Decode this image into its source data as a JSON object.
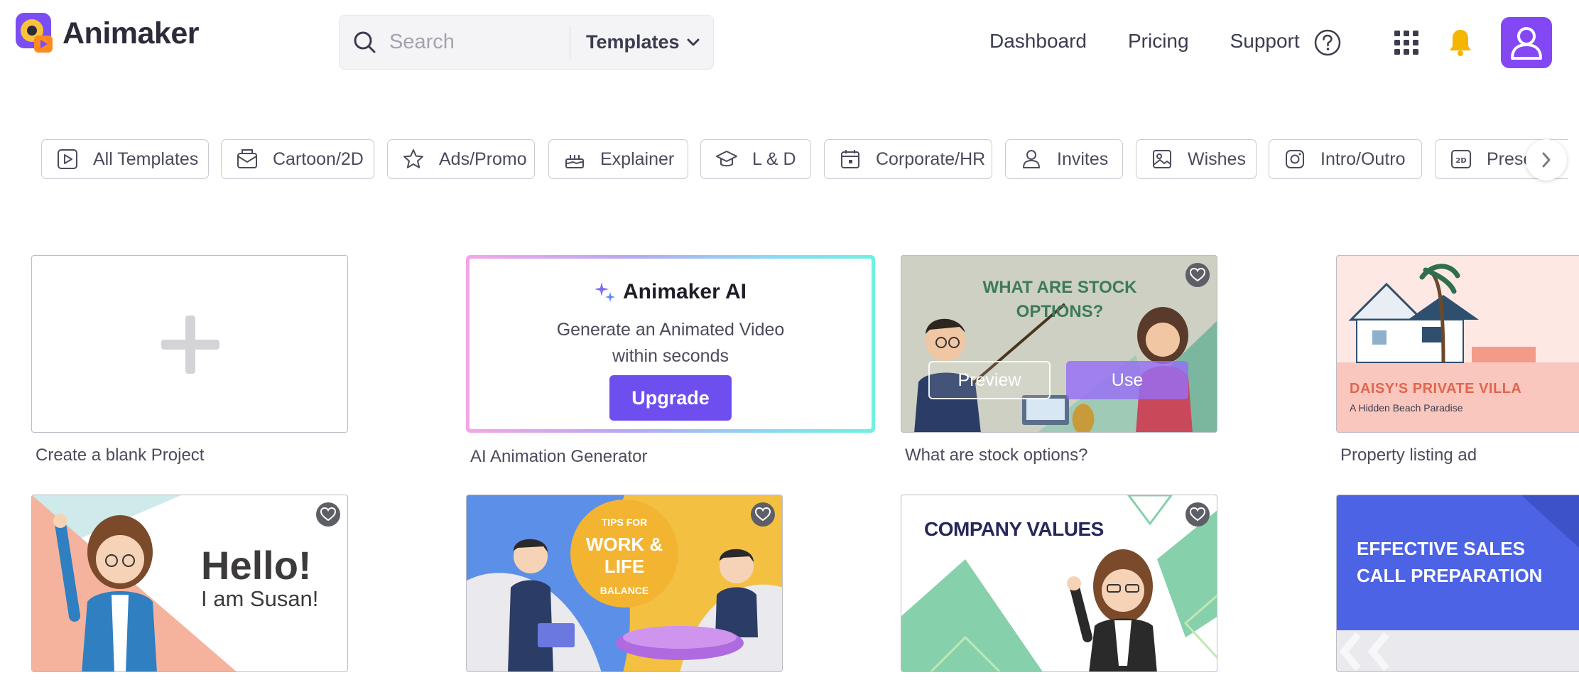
{
  "header": {
    "logo_text": "Animaker",
    "search": {
      "placeholder": "Search",
      "value": ""
    },
    "search_type": "Templates",
    "nav": [
      "Dashboard",
      "Pricing",
      "Support"
    ]
  },
  "categories": [
    {
      "label": "All Templates",
      "icon": "play-icon"
    },
    {
      "label": "Cartoon/2D",
      "icon": "cartoon-icon"
    },
    {
      "label": "Ads/Promo",
      "icon": "star-icon"
    },
    {
      "label": "Explainer",
      "icon": "cake-icon"
    },
    {
      "label": "L & D",
      "icon": "graduation-cap-icon"
    },
    {
      "label": "Corporate/HR",
      "icon": "calendar-icon"
    },
    {
      "label": "Invites",
      "icon": "person-icon"
    },
    {
      "label": "Wishes",
      "icon": "image-icon"
    },
    {
      "label": "Intro/Outro",
      "icon": "instagram-icon"
    },
    {
      "label": "Prese",
      "icon": "2d-icon",
      "badge": "2D"
    }
  ],
  "cards": {
    "blank": {
      "title": "Create a blank Project"
    },
    "ai": {
      "heading": "Animaker AI",
      "desc_line1": "Generate an Animated Video",
      "desc_line2": "within seconds",
      "button": "Upgrade",
      "title": "AI Animation Generator"
    },
    "stock": {
      "heading_line1": "WHAT ARE STOCK",
      "heading_line2": "OPTIONS?",
      "preview": "Preview",
      "use": "Use",
      "title": "What are stock options?"
    },
    "villa": {
      "heading": "DAISY'S PRIVATE VILLA",
      "sub": "A Hidden Beach Paradise",
      "title": "Property listing ad"
    },
    "hello": {
      "line1": "Hello!",
      "line2": "I am Susan!"
    },
    "worklife": {
      "top": "TIPS FOR",
      "main_a": "WORK",
      "amp": "&",
      "main_b": "LIFE",
      "bottom": "BALANCE"
    },
    "values": {
      "heading": "COMPANY VALUES"
    },
    "sales": {
      "line1": "EFFECTIVE SALES",
      "line2": "CALL PREPARATION"
    }
  },
  "colors": {
    "accent": "#6f4ef0",
    "avatar": "#8447f4",
    "bell": "#f5b500"
  }
}
